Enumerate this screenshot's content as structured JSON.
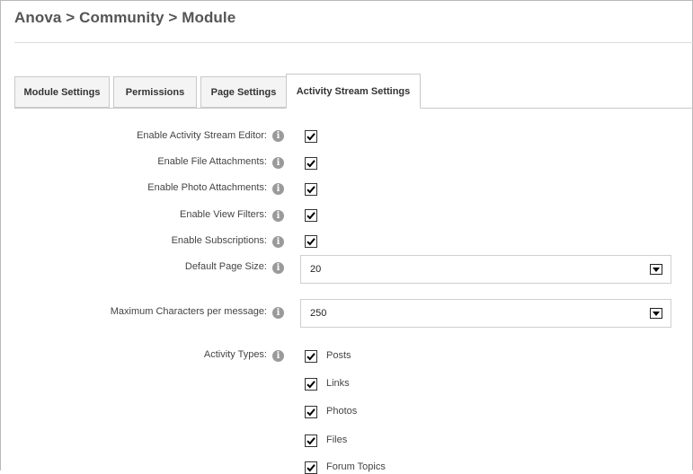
{
  "breadcrumb": "Anova > Community > Module",
  "tabs": [
    {
      "label": "Module Settings",
      "active": false
    },
    {
      "label": "Permissions",
      "active": false
    },
    {
      "label": "Page Settings",
      "active": false
    },
    {
      "label": "Activity Stream Settings",
      "active": true
    }
  ],
  "settings": {
    "enable_editor": {
      "label": "Enable Activity Stream Editor:",
      "checked": true
    },
    "enable_file_attachments": {
      "label": "Enable File Attachments:",
      "checked": true
    },
    "enable_photo_attachments": {
      "label": "Enable Photo Attachments:",
      "checked": true
    },
    "enable_view_filters": {
      "label": "Enable View Filters:",
      "checked": true
    },
    "enable_subscriptions": {
      "label": "Enable Subscriptions:",
      "checked": true
    },
    "default_page_size": {
      "label": "Default Page Size:",
      "value": "20"
    },
    "max_characters": {
      "label": "Maximum Characters per message:",
      "value": "250"
    }
  },
  "activity_types": {
    "label": "Activity Types:",
    "items": [
      {
        "label": "Posts",
        "checked": true
      },
      {
        "label": "Links",
        "checked": true
      },
      {
        "label": "Photos",
        "checked": true
      },
      {
        "label": "Files",
        "checked": true
      },
      {
        "label": "Forum Topics",
        "checked": true
      }
    ]
  },
  "icons": {
    "info": "info-icon",
    "check": "checkmark-icon",
    "dropdown": "dropdown-arrow-icon"
  },
  "colors": {
    "info_icon": "#9a9a9a",
    "tab_border": "#c9c9c9",
    "text": "#444444"
  }
}
